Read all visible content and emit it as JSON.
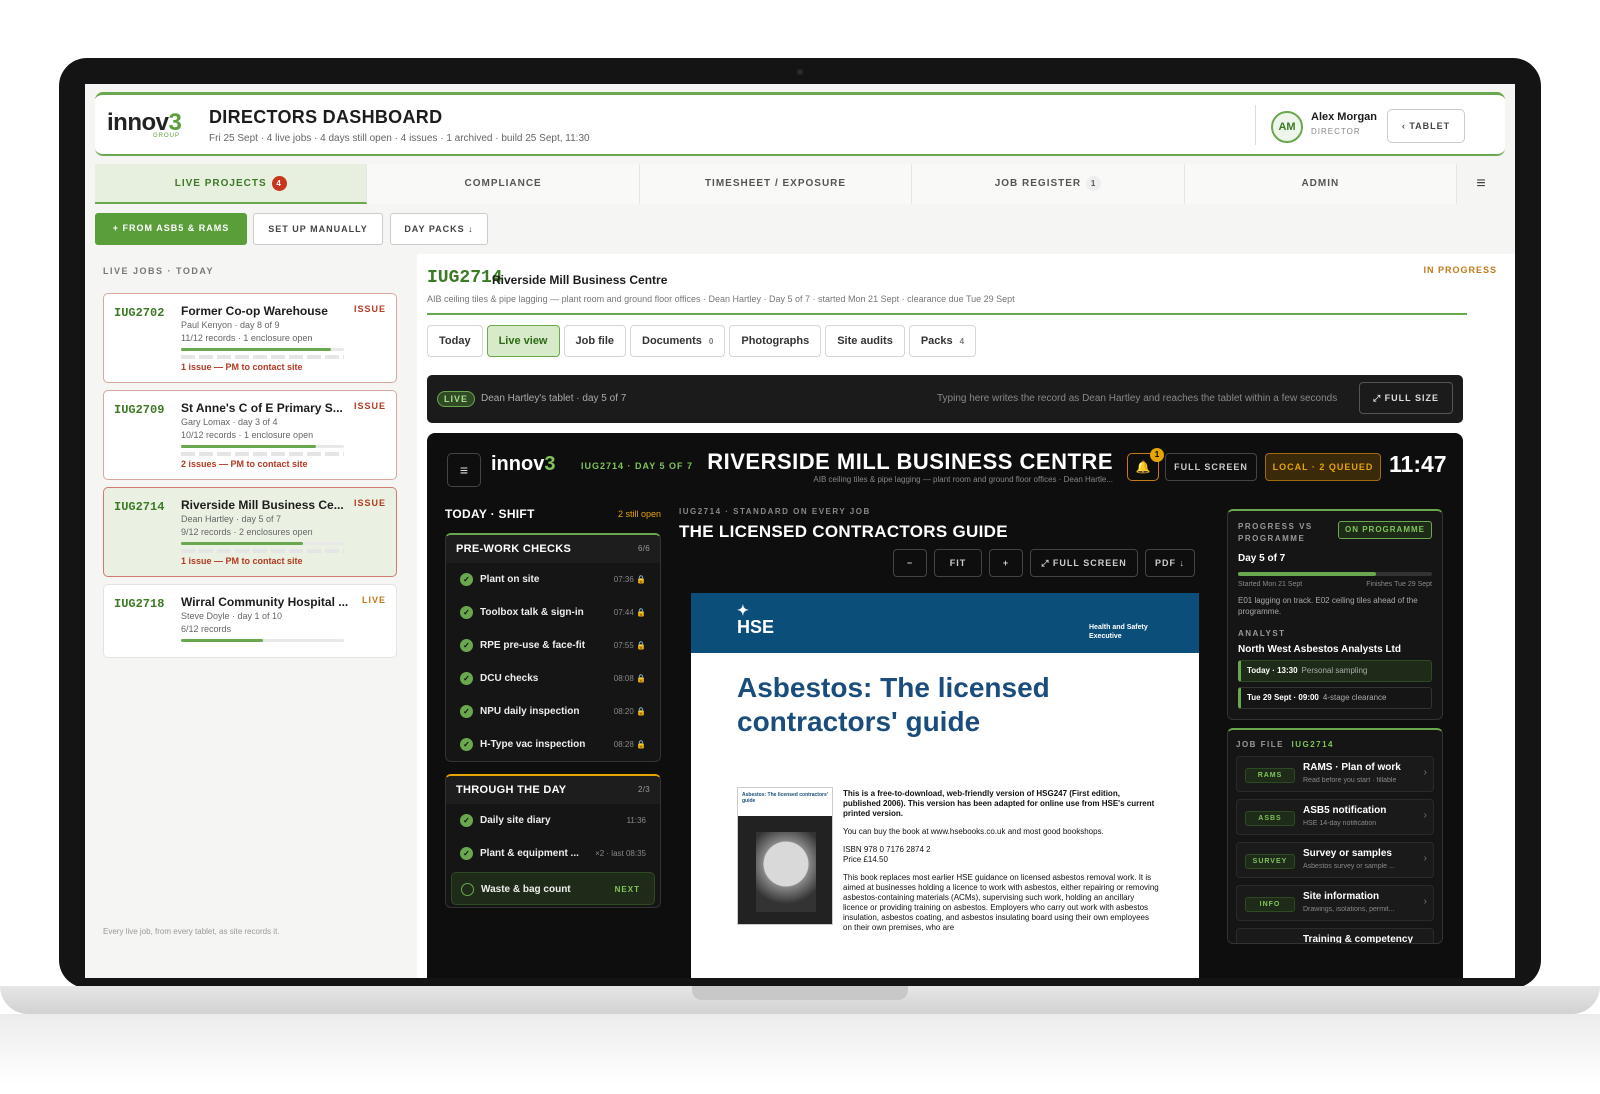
{
  "header": {
    "logo": "innov",
    "logo_mark": "3",
    "logo_sub": "GROUP",
    "title": "DIRECTORS DASHBOARD",
    "subtitle": "Fri 25 Sept · 4 live jobs · 4 days still open · 4 issues · 1 archived · build 25 Sept, 11:30",
    "user_initials": "AM",
    "user_name": "Alex Morgan",
    "user_role": "DIRECTOR",
    "tablet_button": "‹ TABLET"
  },
  "nav": {
    "tabs": [
      {
        "label": "LIVE PROJECTS",
        "count": "4"
      },
      {
        "label": "COMPLIANCE"
      },
      {
        "label": "TIMESHEET / EXPOSURE"
      },
      {
        "label": "JOB REGISTER",
        "count": "1"
      },
      {
        "label": "ADMIN"
      }
    ],
    "menu_icon": "≡"
  },
  "actions": {
    "from_asbs": "+ FROM ASB5 & RAMS",
    "manual": "SET UP MANUALLY",
    "day_packs": "DAY PACKS ↓"
  },
  "left": {
    "heading": "LIVE JOBS · TODAY",
    "jobs": [
      {
        "code": "IUG2702",
        "name": "Former Co-op Warehouse",
        "status": "ISSUE",
        "line2": "Paul Kenyon · day 8 of 9",
        "line3": "11/12 records · 1 enclosure open",
        "progress": 0.92,
        "issue": "1 issue — PM to contact site"
      },
      {
        "code": "IUG2709",
        "name": "St Anne's C of E Primary S...",
        "status": "ISSUE",
        "line2": "Gary Lomax · day 3 of 4",
        "line3": "10/12 records · 1 enclosure open",
        "progress": 0.83,
        "issue": "2 issues — PM to contact site"
      },
      {
        "code": "IUG2714",
        "name": "Riverside Mill Business Ce...",
        "status": "ISSUE",
        "line2": "Dean Hartley · day 5 of 7",
        "line3": "9/12 records · 2 enclosures open",
        "progress": 0.75,
        "issue": "1 issue — PM to contact site"
      },
      {
        "code": "IUG2718",
        "name": "Wirral Community Hospital ...",
        "status": "LIVE",
        "line2": "Steve Doyle · day 1 of 10",
        "line3": "6/12 records",
        "progress": 0.5
      }
    ],
    "footer": "Every live job, from every tablet, as site records it."
  },
  "project": {
    "code": "IUG2714",
    "name": "Riverside Mill Business Centre",
    "status": "IN PROGRESS",
    "subtitle": "AIB ceiling tiles & pipe lagging — plant room and ground floor offices · Dean Hartley · Day 5 of 7 · started Mon 21 Sept · clearance due Tue 29 Sept",
    "tabs": [
      {
        "label": "Today"
      },
      {
        "label": "Live view"
      },
      {
        "label": "Job file"
      },
      {
        "label": "Documents",
        "count": "0"
      },
      {
        "label": "Photographs"
      },
      {
        "label": "Site audits"
      },
      {
        "label": "Packs",
        "count": "4"
      }
    ]
  },
  "livebar": {
    "pill": "LIVE",
    "text": "Dean Hartley's tablet · day 5 of 7",
    "note": "Typing here writes the record as Dean Hartley and reaches the tablet within a few seconds",
    "button": "⤢ FULL SIZE"
  },
  "tablet": {
    "menu_icon": "≡",
    "logo": "innov",
    "logo_mark": "3",
    "job": "IUG2714 · DAY 5 OF 7",
    "title": "RIVERSIDE MILL BUSINESS CENTRE",
    "subtitle": "AIB ceiling tiles & pipe lagging — plant room and ground floor offices · Dean Hartle...",
    "bell_count": "1",
    "full_screen": "FULL SCREEN",
    "local": "LOCAL · 2 QUEUED",
    "clock": "11:47",
    "shift_head": "TODAY · SHIFT",
    "still_open": "2 still open",
    "prework": {
      "title": "PRE-WORK CHECKS",
      "count": "6/6",
      "items": [
        {
          "label": "Plant on site",
          "time": "07:36 🔒"
        },
        {
          "label": "Toolbox talk & sign-in",
          "time": "07:44 🔒"
        },
        {
          "label": "RPE pre-use & face-fit",
          "time": "07:55 🔒"
        },
        {
          "label": "DCU checks",
          "time": "08:08 🔒"
        },
        {
          "label": "NPU daily inspection",
          "time": "08:20 🔒"
        },
        {
          "label": "H-Type vac inspection",
          "time": "08:28 🔒"
        }
      ]
    },
    "throughday": {
      "title": "THROUGH THE DAY",
      "count": "2/3",
      "items": [
        {
          "label": "Daily site diary",
          "time": "11:36"
        },
        {
          "label": "Plant & equipment ...",
          "time": "×2 · last 08:35"
        },
        {
          "label": "Waste & bag count",
          "time": "NEXT"
        }
      ]
    },
    "guide": {
      "kicker": "IUG2714 · STANDARD ON EVERY JOB",
      "title": "THE LICENSED CONTRACTORS GUIDE",
      "controls": [
        "−",
        "FIT",
        "+",
        "⤢ FULL SCREEN",
        "PDF ↓"
      ],
      "hse": "HSE",
      "hse_tag": "Health and Safety Executive",
      "doc_title": "Asbestos: The licensed contractors' guide",
      "cover_title": "Asbestos: The licensed contractors' guide",
      "para1": "This is a free-to-download, web-friendly version of HSG247 (First edition, published 2006). This version has been adapted for online use from HSE's current printed version.",
      "para2": "You can buy the book at www.hsebooks.co.uk and most good bookshops.",
      "para3": "ISBN 978 0 7176 2874 2\nPrice £14.50",
      "para4": "This book replaces most earlier HSE guidance on licensed asbestos removal work. It is aimed at businesses holding a licence to work with asbestos, either repairing or removing asbestos-containing materials (ACMs), supervising such work, holding an ancillary licence or providing training on asbestos. Employers who carry out work with asbestos insulation, asbestos coating, and asbestos insulating board using their own employees on their own premises, who are"
    },
    "progress": {
      "label": "PROGRESS VS PROGRAMME",
      "badge": "ON PROGRAMME",
      "day": "Day 5 of 7",
      "fraction": 0.71,
      "started": "Started Mon 21 Sept",
      "finishes": "Finishes Tue 29 Sept",
      "note": "E01 lagging on track. E02 ceiling tiles ahead of the programme."
    },
    "analyst": {
      "label": "ANALYST",
      "name": "North West Asbestos Analysts Ltd",
      "slots": [
        {
          "when": "Today · 13:30",
          "what": "Personal sampling"
        },
        {
          "when": "Tue 29 Sept · 09:00",
          "what": "4-stage clearance"
        }
      ]
    },
    "jobfile": {
      "label": "JOB FILE",
      "code": "IUG2714",
      "items": [
        {
          "tag": "RAMS",
          "title": "RAMS · Plan of work",
          "sub": "Read before you start · fillable"
        },
        {
          "tag": "ASBS",
          "title": "ASB5 notification",
          "sub": "HSE 14-day notification"
        },
        {
          "tag": "SURVEY",
          "title": "Survey or samples",
          "sub": "Asbestos survey or sample ..."
        },
        {
          "tag": "INFO",
          "title": "Site information",
          "sub": "Drawings, isolations, permit..."
        },
        {
          "tag": "",
          "title": "Training & competency",
          "sub": ""
        }
      ]
    }
  },
  "colors": {
    "accent": "#6aa84f",
    "issue": "#b33a22",
    "amber": "#e6a400",
    "hse_blue": "#0c4e7a"
  }
}
